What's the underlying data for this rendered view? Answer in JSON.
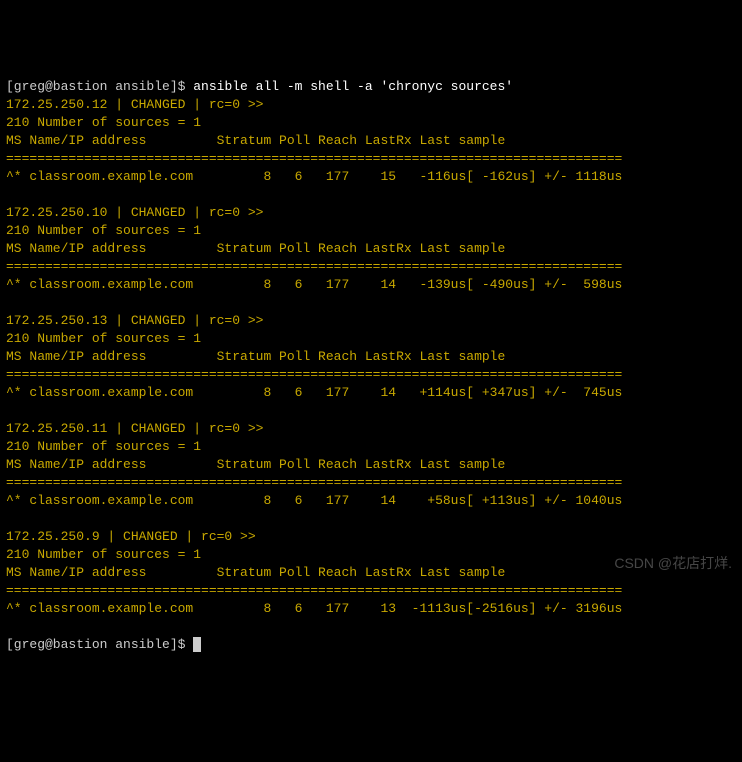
{
  "prompt1": "[greg@bastion ansible]$ ",
  "command": "ansible all -m shell -a 'chronyc sources'",
  "divider": "===============================================================================",
  "sourcesLine": "210 Number of sources = 1",
  "headerLine": "MS Name/IP address         Stratum Poll Reach LastRx Last sample",
  "hosts": [
    {
      "status": "172.25.250.12 | CHANGED | rc=0 >>",
      "data": "^* classroom.example.com         8   6   177    15   -116us[ -162us] +/- 1118us"
    },
    {
      "status": "172.25.250.10 | CHANGED | rc=0 >>",
      "data": "^* classroom.example.com         8   6   177    14   -139us[ -490us] +/-  598us"
    },
    {
      "status": "172.25.250.13 | CHANGED | rc=0 >>",
      "data": "^* classroom.example.com         8   6   177    14   +114us[ +347us] +/-  745us"
    },
    {
      "status": "172.25.250.11 | CHANGED | rc=0 >>",
      "data": "^* classroom.example.com         8   6   177    14    +58us[ +113us] +/- 1040us"
    },
    {
      "status": "172.25.250.9 | CHANGED | rc=0 >>",
      "data": "^* classroom.example.com         8   6   177    13  -1113us[-2516us] +/- 3196us"
    }
  ],
  "prompt2": "[greg@bastion ansible]$ ",
  "watermark": "CSDN @花店打烊."
}
